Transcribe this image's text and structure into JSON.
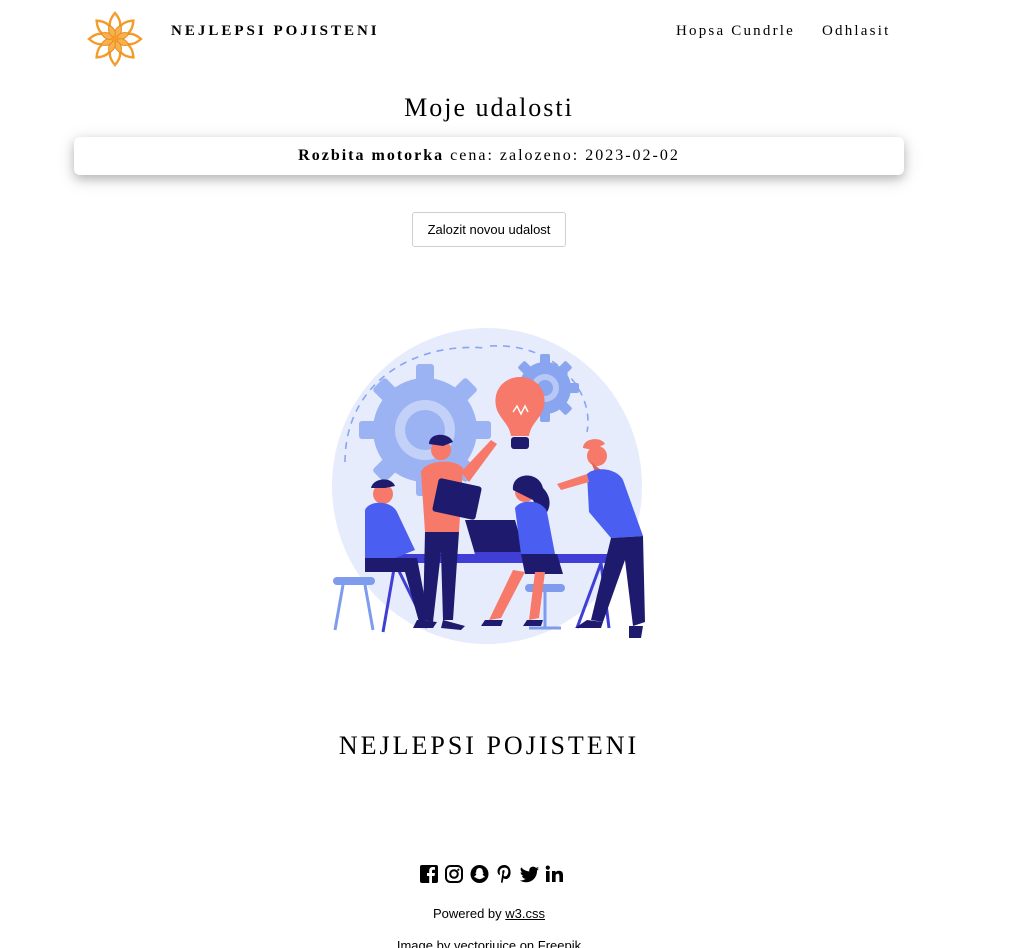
{
  "header": {
    "brand": "NEJLEPSI POJISTENI",
    "user_name": "Hopsa Cundrle",
    "logout_label": "Odhlasit",
    "logo_icon": "orange-flower-logo"
  },
  "main": {
    "title": "Moje udalosti",
    "events": [
      {
        "name": "Rozbita motorka",
        "details": "cena: zalozeno: 2023-02-02"
      }
    ],
    "new_event_label": "Zalozit novou udalost",
    "illustration": "team-brainstorm-illustration"
  },
  "footer": {
    "title": "NEJLEPSI POJISTENI",
    "social_icons": [
      "facebook-icon",
      "instagram-icon",
      "snapchat-icon",
      "pinterest-icon",
      "twitter-icon",
      "linkedin-icon"
    ],
    "powered_prefix": "Powered by",
    "powered_link": "w3.css",
    "credit": "Image by vectorjuice on Freepik"
  },
  "colors": {
    "logo_orange": "#f4a23a",
    "illustration_blue": "#4b5ef2",
    "illustration_coral": "#f7796a"
  }
}
